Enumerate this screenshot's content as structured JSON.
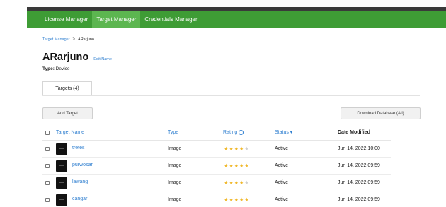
{
  "nav": {
    "items": [
      {
        "label": "License Manager",
        "active": false
      },
      {
        "label": "Target Manager",
        "active": true
      },
      {
        "label": "Credentials Manager",
        "active": false
      }
    ],
    "bar_color": "#3e9c35",
    "active_color": "#5cb650"
  },
  "breadcrumb": {
    "parent": "Target Manager",
    "separator": ">",
    "current": "ARarjuno"
  },
  "database": {
    "name": "ARarjuno",
    "edit_label": "Edit Name",
    "type_label": "Type:",
    "type_value": "Device"
  },
  "tabs": [
    {
      "label": "Targets (4)",
      "active": true
    }
  ],
  "actions": {
    "add_target": "Add Target",
    "download_database": "Download Database (All)"
  },
  "table": {
    "headers": {
      "name": "Target Name",
      "type": "Type",
      "rating": "Rating",
      "status": "Status",
      "date": "Date Modified"
    },
    "rows": [
      {
        "name": "tretes",
        "type": "Image",
        "rating": 4,
        "status": "Active",
        "date": "Jun 14, 2022 10:00"
      },
      {
        "name": "purwosari",
        "type": "Image",
        "rating": 5,
        "status": "Active",
        "date": "Jun 14, 2022 09:59"
      },
      {
        "name": "lawang",
        "type": "Image",
        "rating": 4,
        "status": "Active",
        "date": "Jun 14, 2022 09:59"
      },
      {
        "name": "cangar",
        "type": "Image",
        "rating": 5,
        "status": "Active",
        "date": "Jun 14, 2022 09:59"
      }
    ],
    "rating_max": 5
  },
  "icons": {
    "info": "info-icon",
    "sort": "chevron-down-icon",
    "breadcrumb_sep": "chevron-right-icon"
  }
}
